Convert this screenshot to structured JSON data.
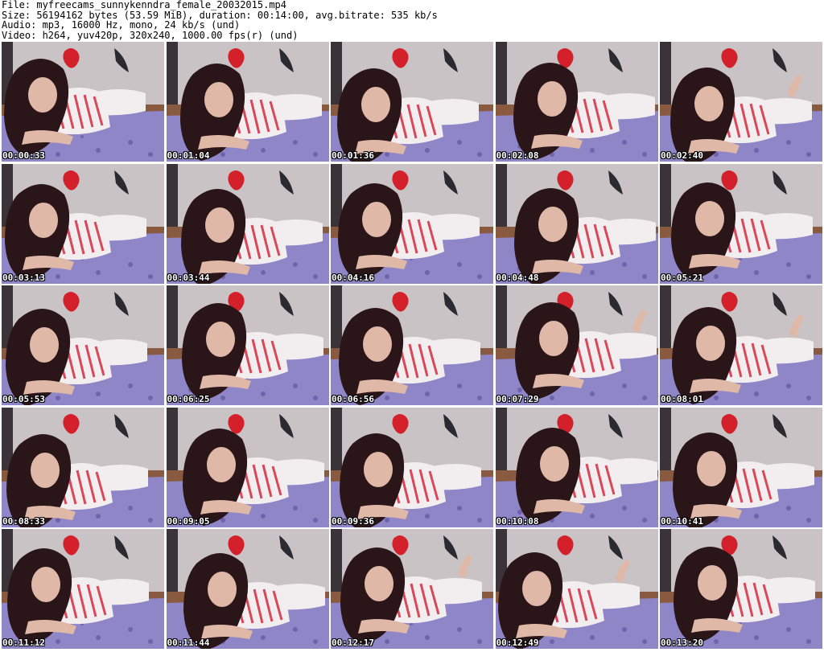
{
  "header": {
    "file_line": "File: myfreecams_sunnykenndra_female_20032015.mp4",
    "size_line": "Size: 56194162 bytes (53.59 MiB), duration: 00:14:00, avg.bitrate: 535 kb/s",
    "audio_line": "Audio: mp3, 16000 Hz, mono, 24 kb/s (und)",
    "video_line": "Video: h264, yuv420p, 320x240, 1000.00 fps(r) (und)"
  },
  "thumbnails": [
    {
      "timestamp": "00:00:33"
    },
    {
      "timestamp": "00:01:04"
    },
    {
      "timestamp": "00:01:36"
    },
    {
      "timestamp": "00:02:08"
    },
    {
      "timestamp": "00:02:40"
    },
    {
      "timestamp": "00:03:13"
    },
    {
      "timestamp": "00:03:44"
    },
    {
      "timestamp": "00:04:16"
    },
    {
      "timestamp": "00:04:48"
    },
    {
      "timestamp": "00:05:21"
    },
    {
      "timestamp": "00:05:53"
    },
    {
      "timestamp": "00:06:25"
    },
    {
      "timestamp": "00:06:56"
    },
    {
      "timestamp": "00:07:29"
    },
    {
      "timestamp": "00:08:01"
    },
    {
      "timestamp": "00:08:33"
    },
    {
      "timestamp": "00:09:05"
    },
    {
      "timestamp": "00:09:36"
    },
    {
      "timestamp": "00:10:08"
    },
    {
      "timestamp": "00:10:41"
    },
    {
      "timestamp": "00:11:12"
    },
    {
      "timestamp": "00:11:44"
    },
    {
      "timestamp": "00:12:17"
    },
    {
      "timestamp": "00:12:49"
    },
    {
      "timestamp": "00:13:20"
    }
  ],
  "colors": {
    "wall": "#c9c3c6",
    "headboard": "#8a5a40",
    "bedspread": "#8f86c8",
    "bed_pattern": "#5b4e9a",
    "hair": "#2a1518",
    "skin": "#e0b8a8",
    "shirt_white": "#f2eef0",
    "shirt_stripe": "#d9485a",
    "wall_lips": "#d4202a",
    "wall_feather": "#2b2a30"
  },
  "icons": {
    "wall_decoration": "red-lips-decal",
    "wall_feather": "black-feather-decal"
  }
}
